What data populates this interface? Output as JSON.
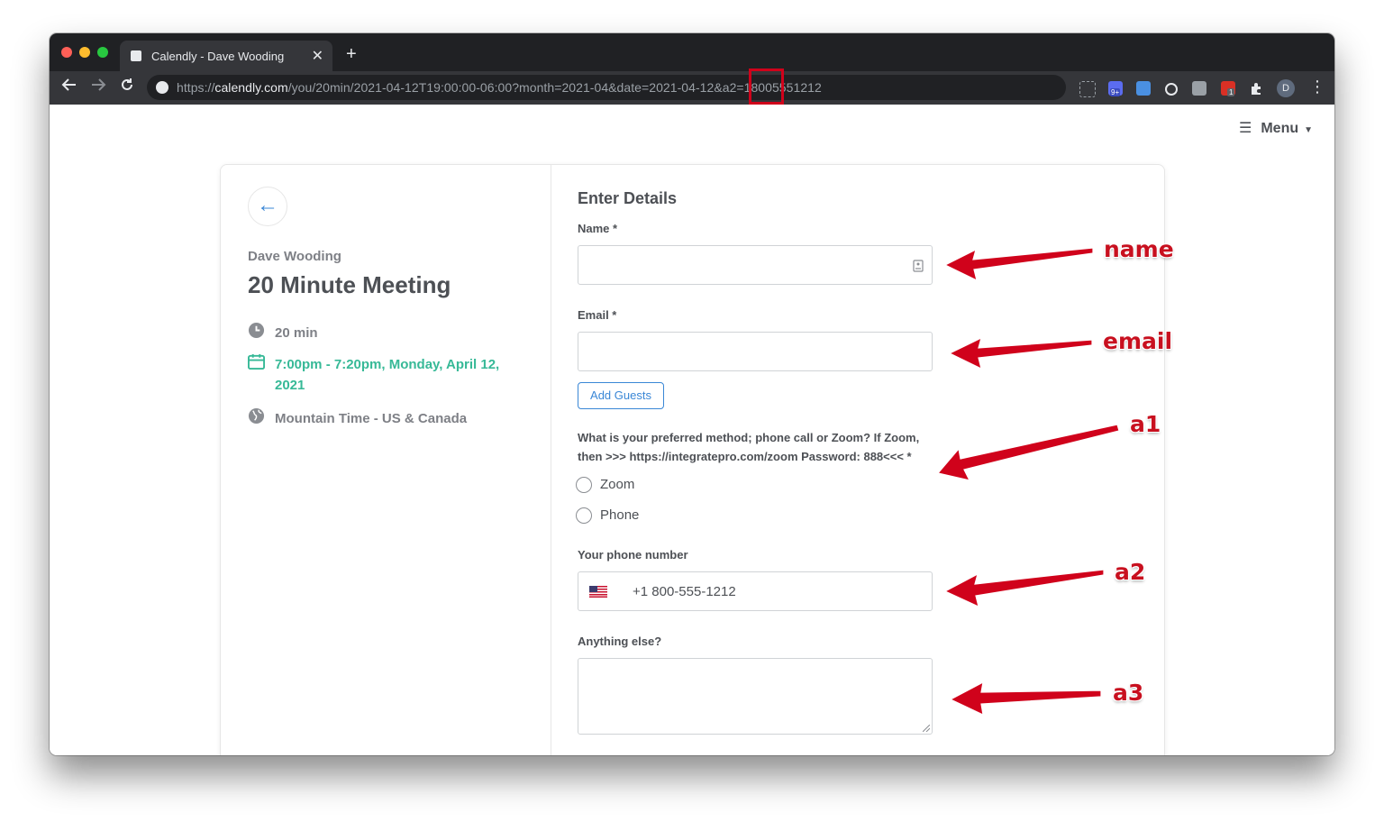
{
  "browser": {
    "tab_title": "Calendly - Dave Wooding",
    "tab_close": "✕",
    "new_tab": "+",
    "url_scheme": "https://",
    "url_host": "calendly.com",
    "url_path": "/you/20min/2021-04-12T19:00:00-06:00?month=2021-04&date=2021-04-12&a2=18005551212",
    "profile_initial": "D",
    "extension_badge_1": "9+",
    "extension_badge_2": "1"
  },
  "page": {
    "menu_label": "Menu",
    "owner_name": "Dave Wooding",
    "event_title": "20 Minute Meeting",
    "duration": "20 min",
    "datetime_line1": "7:00pm - 7:20pm, Monday, April 12,",
    "datetime_line2": "2021",
    "timezone": "Mountain Time - US & Canada"
  },
  "form": {
    "heading": "Enter Details",
    "name_label": "Name *",
    "email_label": "Email *",
    "add_guests": "Add Guests",
    "question_line1": "What is your preferred method; phone call or Zoom? If Zoom,",
    "question_line2": "then >>> https://integratepro.com/zoom Password: 888<<< *",
    "option_zoom": "Zoom",
    "option_phone": "Phone",
    "phone_label": "Your phone number",
    "phone_value": "+1 800-555-1212",
    "anything_label": "Anything else?"
  },
  "annotations": {
    "name": "name",
    "email": "email",
    "a1": "a1",
    "a2": "a2",
    "a3": "a3"
  },
  "colors": {
    "accent_blue": "#3a87d6",
    "accent_green": "#37b997",
    "annotation_red": "#d0021b"
  }
}
